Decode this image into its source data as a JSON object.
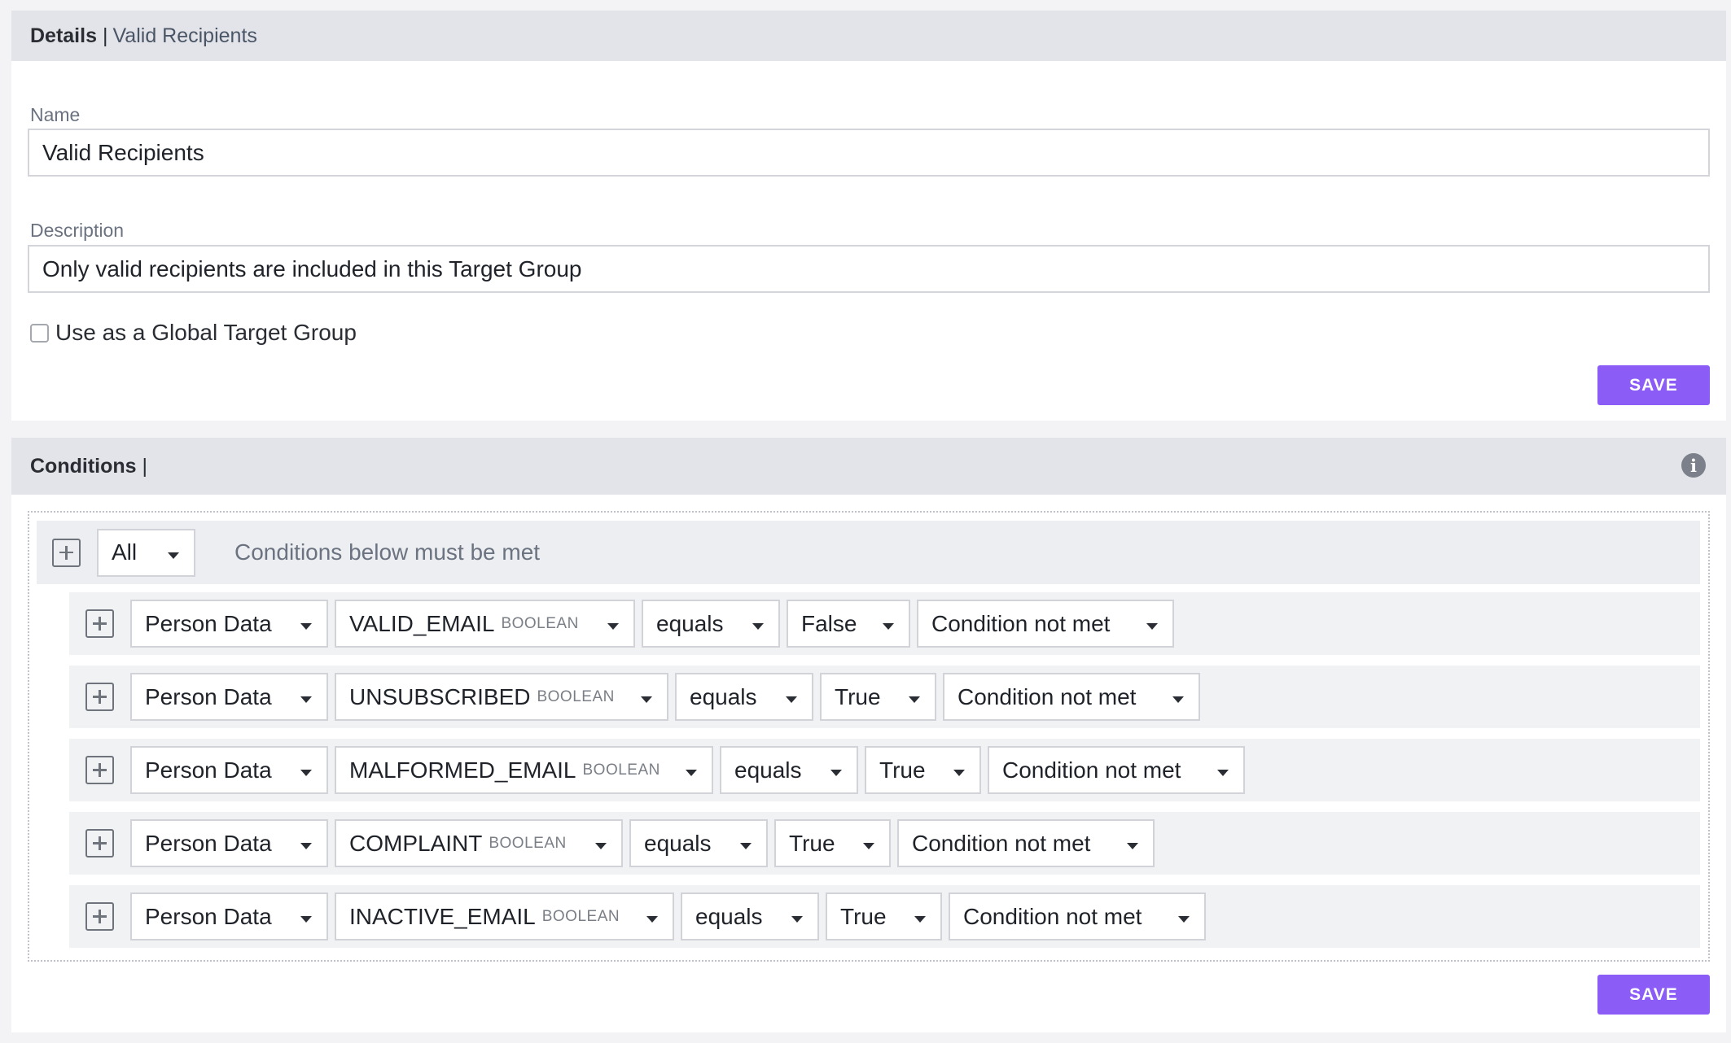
{
  "details": {
    "title": "Details",
    "separator": "|",
    "subtitle": "Valid Recipients",
    "name_label": "Name",
    "name_value": "Valid Recipients",
    "description_label": "Description",
    "description_value": "Only valid recipients are included in this Target Group",
    "global_checkbox_label": "Use as a Global Target Group",
    "global_checked": false,
    "save_label": "SAVE"
  },
  "conditions": {
    "title": "Conditions",
    "separator": "|",
    "info_icon": "info-icon",
    "match_mode": "All",
    "match_description": "Conditions below must be met",
    "save_label": "SAVE",
    "rows": [
      {
        "source": "Person Data",
        "field": "VALID_EMAIL",
        "field_type": "BOOLEAN",
        "operator": "equals",
        "value": "False",
        "outcome": "Condition not met"
      },
      {
        "source": "Person Data",
        "field": "UNSUBSCRIBED",
        "field_type": "BOOLEAN",
        "operator": "equals",
        "value": "True",
        "outcome": "Condition not met"
      },
      {
        "source": "Person Data",
        "field": "MALFORMED_EMAIL",
        "field_type": "BOOLEAN",
        "operator": "equals",
        "value": "True",
        "outcome": "Condition not met"
      },
      {
        "source": "Person Data",
        "field": "COMPLAINT",
        "field_type": "BOOLEAN",
        "operator": "equals",
        "value": "True",
        "outcome": "Condition not met"
      },
      {
        "source": "Person Data",
        "field": "INACTIVE_EMAIL",
        "field_type": "BOOLEAN",
        "operator": "equals",
        "value": "True",
        "outcome": "Condition not met"
      }
    ]
  },
  "colors": {
    "accent": "#8b5cf6",
    "header_bg": "#e3e4e9",
    "page_bg": "#f3f3f5"
  }
}
